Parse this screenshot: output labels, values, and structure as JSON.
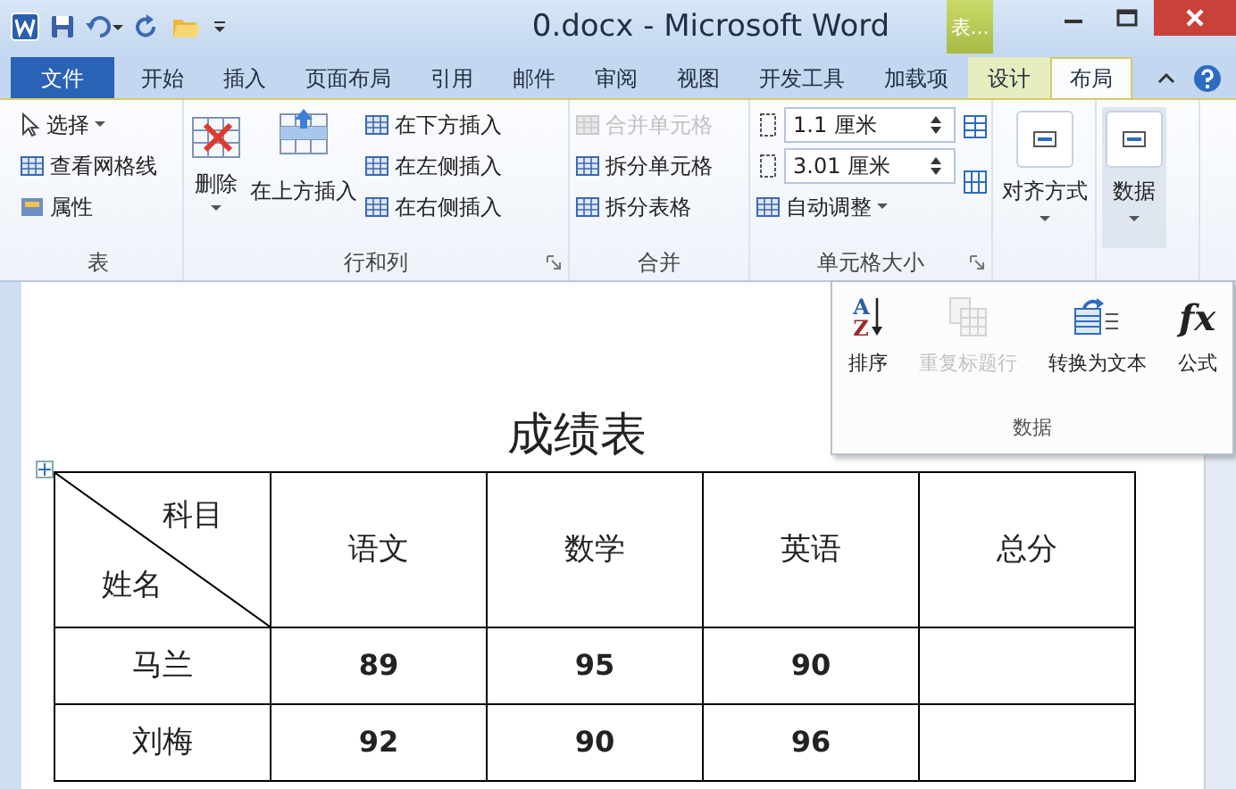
{
  "window": {
    "title": "0.docx - Microsoft Word",
    "context_tab": "表..."
  },
  "tabs": [
    {
      "label": "文件",
      "kind": "file",
      "selected": false
    },
    {
      "label": "开始",
      "kind": "tab",
      "selected": false
    },
    {
      "label": "插入",
      "kind": "tab",
      "selected": false
    },
    {
      "label": "页面布局",
      "kind": "tab",
      "selected": false
    },
    {
      "label": "引用",
      "kind": "tab",
      "selected": false
    },
    {
      "label": "邮件",
      "kind": "tab",
      "selected": false
    },
    {
      "label": "审阅",
      "kind": "tab",
      "selected": false
    },
    {
      "label": "视图",
      "kind": "tab",
      "selected": false
    },
    {
      "label": "开发工具",
      "kind": "tab",
      "selected": false
    },
    {
      "label": "加载项",
      "kind": "tab",
      "selected": false
    },
    {
      "label": "设计",
      "kind": "context",
      "selected": false
    },
    {
      "label": "布局",
      "kind": "context",
      "selected": true
    }
  ],
  "ribbon": {
    "groups": [
      {
        "label": "表",
        "columns": [
          [
            {
              "kind": "small",
              "label": "选择",
              "dropdown": true,
              "disabled": false
            },
            {
              "kind": "small",
              "label": "查看网格线",
              "disabled": false
            },
            {
              "kind": "small",
              "label": "属性",
              "disabled": false
            }
          ]
        ]
      },
      {
        "label": "行和列",
        "launcher": true,
        "columns": [
          [
            {
              "kind": "large",
              "label": "删除",
              "dropdown": true,
              "disabled": false
            }
          ],
          [
            {
              "kind": "large",
              "label": "在上方插入",
              "disabled": false
            }
          ],
          [
            {
              "kind": "small",
              "label": "在下方插入",
              "disabled": false
            },
            {
              "kind": "small",
              "label": "在左侧插入",
              "disabled": false
            },
            {
              "kind": "small",
              "label": "在右侧插入",
              "disabled": false
            }
          ]
        ]
      },
      {
        "label": "合并",
        "columns": [
          [
            {
              "kind": "small",
              "label": "合并单元格",
              "disabled": true
            },
            {
              "kind": "small",
              "label": "拆分单元格",
              "disabled": false
            },
            {
              "kind": "small",
              "label": "拆分表格",
              "disabled": false
            }
          ]
        ]
      },
      {
        "label": "单元格大小",
        "launcher": true,
        "columns": [
          [
            {
              "kind": "spin",
              "value": "1.1 厘米"
            },
            {
              "kind": "spin",
              "value": "3.01 厘米"
            },
            {
              "kind": "small",
              "label": "自动调整",
              "dropdown": true,
              "disabled": false
            }
          ],
          [
            {
              "kind": "iconbtn"
            },
            {
              "kind": "iconbtn"
            }
          ]
        ]
      },
      {
        "columns": [
          [
            {
              "kind": "collapsed",
              "label": "对齐方式",
              "expanded": false
            }
          ]
        ]
      },
      {
        "columns": [
          [
            {
              "kind": "collapsed",
              "label": "数据",
              "expanded": true
            }
          ]
        ]
      }
    ]
  },
  "popup": {
    "label": "数据",
    "items": [
      {
        "label": "排序",
        "kind": "sort",
        "icon_letters": [
          "A",
          "Z"
        ],
        "disabled": false
      },
      {
        "label": "重复标题行",
        "kind": "repeat",
        "disabled": true
      },
      {
        "label": "转换为文本",
        "kind": "convert",
        "disabled": false
      },
      {
        "label": "公式",
        "kind": "formula",
        "icon_text": "fx",
        "disabled": false
      }
    ]
  },
  "document": {
    "title": "成绩表",
    "table": {
      "columns": [
        {
          "kind": "diagonal",
          "top": "科目",
          "bottom": "姓名"
        },
        {
          "label": "语文"
        },
        {
          "label": "数学"
        },
        {
          "label": "英语"
        },
        {
          "label": "总分"
        }
      ],
      "rows": [
        [
          "马兰",
          "89",
          "95",
          "90",
          ""
        ],
        [
          "刘梅",
          "92",
          "90",
          "96",
          ""
        ]
      ]
    }
  }
}
